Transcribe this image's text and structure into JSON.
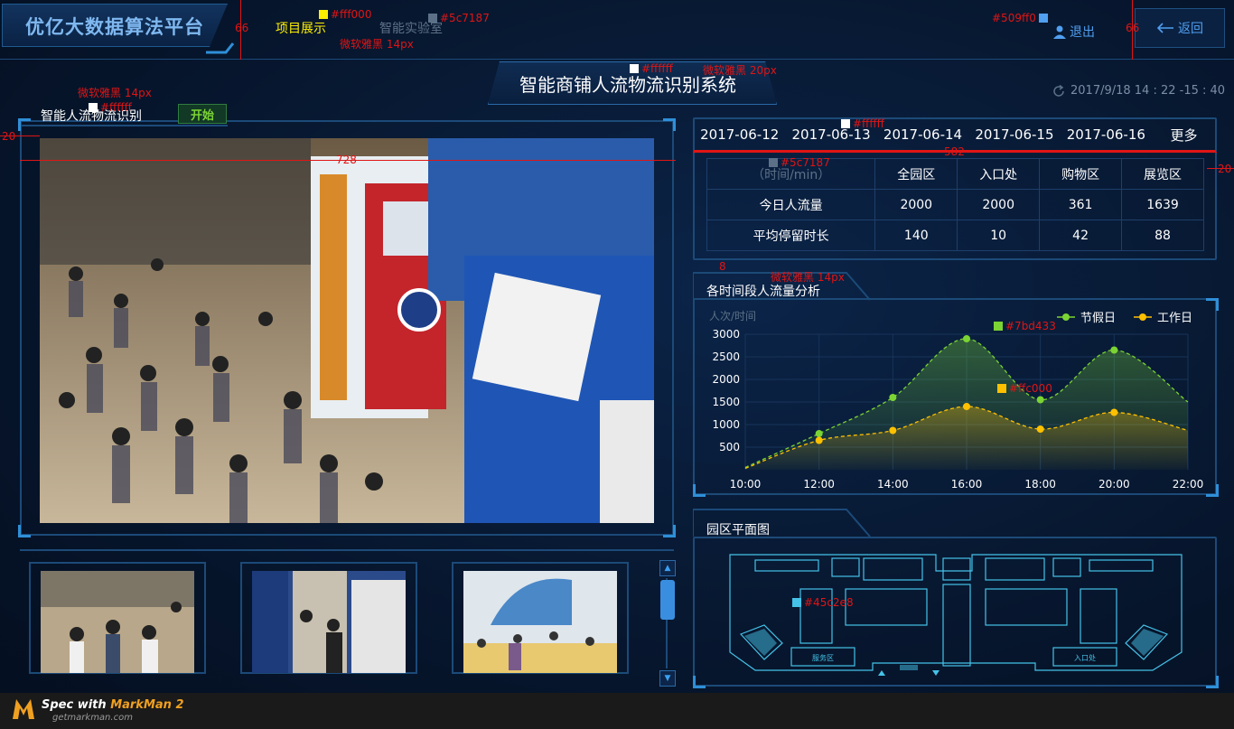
{
  "header": {
    "logo": "优亿大数据算法平台",
    "nav": [
      {
        "label": "项目展示"
      },
      {
        "label": "智能实验室"
      }
    ],
    "logout": "退出",
    "back": "返回",
    "title": "智能商铺人流物流识别系统",
    "datetime": "2017/9/18  14 : 22  -15 : 40"
  },
  "left_panel": {
    "title": "智能人流物流识别",
    "start_button": "开始"
  },
  "date_tabs": [
    "2017-06-12",
    "2017-06-13",
    "2017-06-14",
    "2017-06-15",
    "2017-06-16",
    "更多"
  ],
  "table": {
    "headers": [
      "（时间/min）",
      "全园区",
      "入口处",
      "购物区",
      "展览区"
    ],
    "rows": [
      {
        "label": "今日人流量",
        "values": [
          "2000",
          "2000",
          "361",
          "1639"
        ]
      },
      {
        "label": "平均停留时长",
        "values": [
          "140",
          "10",
          "42",
          "88"
        ]
      }
    ]
  },
  "chart_section_title": "各时间段人流量分析",
  "chart_data": {
    "type": "area",
    "ylabel": "人次/时间",
    "x": [
      "10:00",
      "12:00",
      "14:00",
      "16:00",
      "18:00",
      "20:00",
      "22:00"
    ],
    "yticks": [
      500,
      1000,
      1500,
      2000,
      2500,
      3000
    ],
    "ylim": [
      0,
      3000
    ],
    "legend": "top-right",
    "series": [
      {
        "name": "节假日",
        "color": "#7bd433",
        "points": [
          [
            10,
            50
          ],
          [
            12,
            800
          ],
          [
            14,
            1600
          ],
          [
            16,
            2900
          ],
          [
            18,
            1550
          ],
          [
            20,
            2650
          ],
          [
            22,
            1500
          ]
        ]
      },
      {
        "name": "工作日",
        "color": "#ffc000",
        "points": [
          [
            10,
            30
          ],
          [
            12,
            650
          ],
          [
            14,
            870
          ],
          [
            16,
            1400
          ],
          [
            18,
            900
          ],
          [
            20,
            1270
          ],
          [
            22,
            870
          ]
        ]
      }
    ]
  },
  "map_section_title": "园区平面图",
  "map_labels": [
    "服务区",
    "入口处"
  ],
  "annotations": {
    "c1": "#fff000",
    "c2": "#5c7187",
    "c3": "#509ff0",
    "c4": "#ffffff",
    "c5": "#ffffff",
    "c6": "#ffffff",
    "c7": "#5c7187",
    "c8": "#7bd433",
    "c9": "#ffc000",
    "c10": "#45c2e8",
    "f1": "微软雅黑  14px",
    "f2": "微软雅黑  20px",
    "f3": "微软雅黑  14px",
    "f4": "微软雅黑  14px",
    "d66a": "66",
    "d66b": "66",
    "d20a": "20",
    "d20b": "20",
    "d728": "728",
    "d582": "582",
    "d8": "8"
  },
  "footer": {
    "brand_prefix": "Spec with ",
    "brand_name": "MarkMan 2",
    "url": "getmarkman.com"
  }
}
